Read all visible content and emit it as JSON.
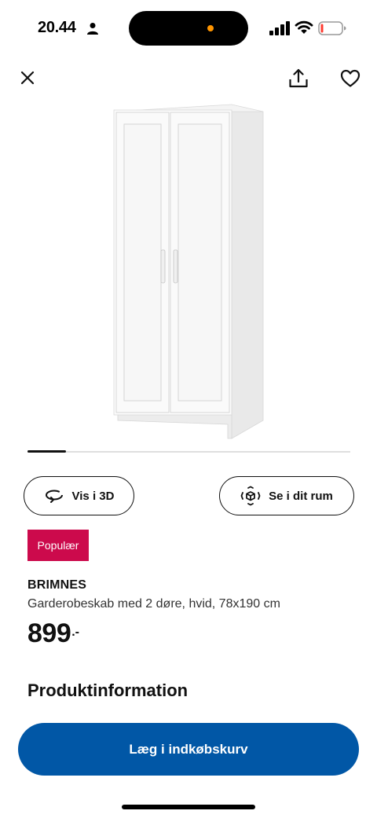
{
  "status_bar": {
    "time": "20.44",
    "island_dot_color": "#ff9500",
    "battery_level_color": "#ff3b30",
    "icons": [
      "person-icon",
      "signal-icon",
      "wifi-icon",
      "battery-icon"
    ]
  },
  "toolbar": {
    "close_icon": "close-icon",
    "share_icon": "share-icon",
    "favorite_icon": "heart-icon"
  },
  "gallery": {
    "image_subject": "wardrobe-image",
    "progress": 0.12
  },
  "actions": {
    "view_3d_label": "Vis i 3D",
    "view_3d_icon": "rotate-3d-icon",
    "in_room_label": "Se i dit rum",
    "in_room_icon": "ar-cube-icon"
  },
  "badge": {
    "label": "Populær",
    "color": "#cc0a4c"
  },
  "product": {
    "name": "BRIMNES",
    "description": "Garderobeskab med 2 døre, hvid, 78x190 cm",
    "price_integer": "899",
    "price_suffix": ".-"
  },
  "section": {
    "heading": "Produktinformation"
  },
  "cta": {
    "label": "Læg i indkøbskurv",
    "color": "#0157a6"
  }
}
